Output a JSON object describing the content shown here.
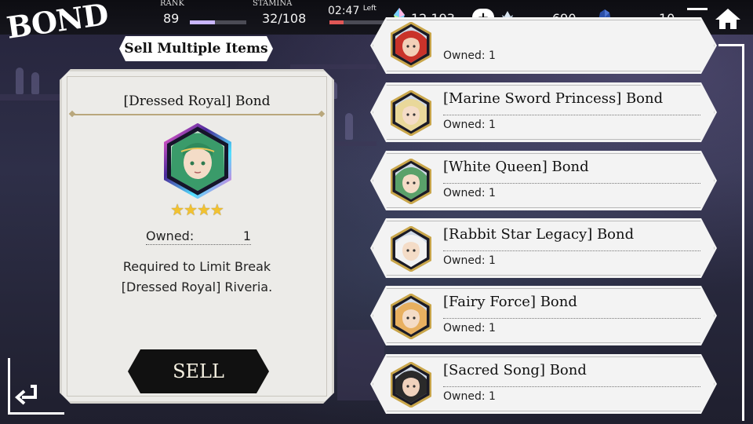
{
  "header": {
    "brand": "BOND",
    "rank_label": "RANK",
    "rank_value": "89",
    "rank_progress": 0.45,
    "stamina_label": "STAMINA",
    "stamina_value": "32/108",
    "timer": "02:47",
    "timer_suffix": "Left",
    "timer_progress": 0.25,
    "crystals": "12,193",
    "currency2": "690",
    "currency3": "10"
  },
  "title": "Sell Multiple Items",
  "detail": {
    "name": "[Dressed Royal] Bond",
    "stars": "★★★★",
    "owned_label": "Owned:",
    "owned_value": "1",
    "requirement_line1": "Required to Limit Break",
    "requirement_line2": "[Dressed Royal] Riveria.",
    "sell_label": "SELL"
  },
  "items": [
    {
      "name": "",
      "owned": "Owned: 1",
      "hair": "#c9332a",
      "skin": "#f2d0b8"
    },
    {
      "name": "[Marine Sword Princess] Bond",
      "owned": "Owned: 1",
      "hair": "#e9d89a",
      "skin": "#f4dcc7"
    },
    {
      "name": "[White Queen] Bond",
      "owned": "Owned: 1",
      "hair": "#5aa16a",
      "skin": "#f4dcc7"
    },
    {
      "name": "[Rabbit Star Legacy] Bond",
      "owned": "Owned: 1",
      "hair": "#f2f2f2",
      "skin": "#f4dcc7"
    },
    {
      "name": "[Fairy Force] Bond",
      "owned": "Owned: 1",
      "hair": "#e8b060",
      "skin": "#f4dcc7"
    },
    {
      "name": "[Sacred Song] Bond",
      "owned": "Owned: 1",
      "hair": "#2a2a2a",
      "skin": "#f0d2bd"
    }
  ],
  "colors": {
    "rank_bar": "#c9b6ff",
    "timer_bar": "#e05656",
    "crystal": "#7ad0ff",
    "gem_blue": "#2b4fa8"
  }
}
